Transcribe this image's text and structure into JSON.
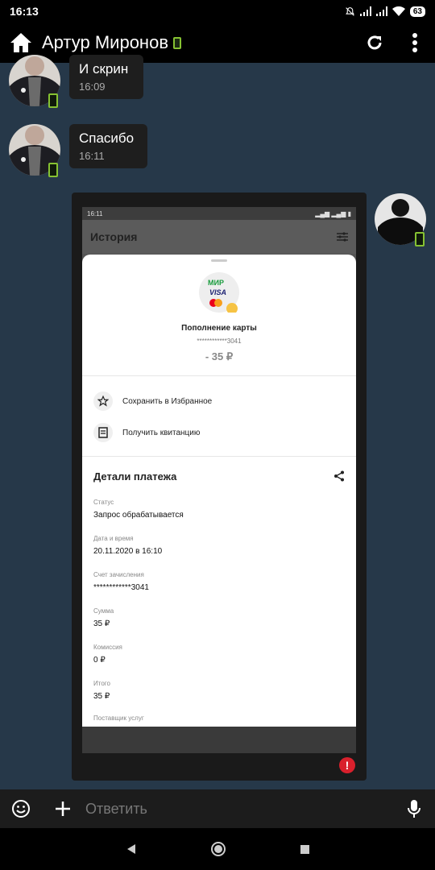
{
  "status_bar": {
    "time": "16:13",
    "battery": "63",
    "icons": [
      "bell-off-icon",
      "signal-icon",
      "signal-icon",
      "wifi-icon",
      "battery-icon"
    ]
  },
  "app_bar": {
    "title": "Артур Миронов",
    "icons": [
      "home-icon",
      "refresh-icon",
      "more-vert-icon"
    ]
  },
  "messages": [
    {
      "text": "И скрин",
      "time": "16:09"
    },
    {
      "text": "Спасибо",
      "time": "16:11"
    }
  ],
  "screenshot": {
    "status_time": "16:11",
    "header_title": "История",
    "card_logo_text": "МИР",
    "card_visa_text": "VISA",
    "operation_title": "Пополнение карты",
    "card_mask": "************3041",
    "amount": "- 35 ₽",
    "actions": [
      "Сохранить в Избранное",
      "Получить квитанцию"
    ],
    "details_title": "Детали платежа",
    "details": [
      {
        "label": "Статус",
        "value": "Запрос обрабатывается"
      },
      {
        "label": "Дата и время",
        "value": "20.11.2020 в 16:10"
      },
      {
        "label": "Счет зачисления",
        "value": "************3041"
      },
      {
        "label": "Сумма",
        "value": "35 ₽"
      },
      {
        "label": "Комиссия",
        "value": "0 ₽"
      },
      {
        "label": "Итого",
        "value": "35 ₽"
      },
      {
        "label": "Поставщик услуг",
        "value": ""
      }
    ]
  },
  "error_badge": "!",
  "composer": {
    "placeholder": "Ответить",
    "icons": [
      "emoji-icon",
      "plus-icon",
      "mic-icon"
    ]
  },
  "colors": {
    "background": "#263849",
    "bubble": "#1e1e1e",
    "accent_green": "#86c232",
    "error_red": "#d9202c"
  }
}
